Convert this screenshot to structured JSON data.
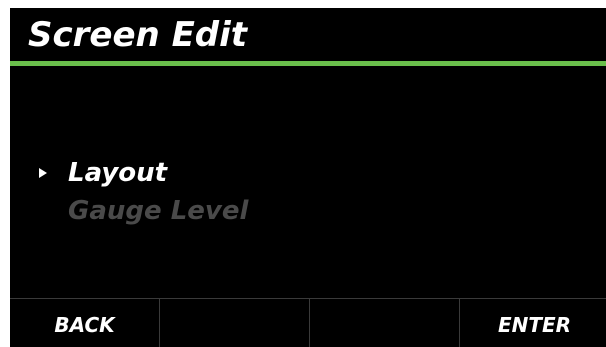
{
  "header": {
    "title": "Screen Edit",
    "accent_color": "#6abf4b"
  },
  "menu": {
    "items": [
      {
        "label": "Layout",
        "state": "selected"
      },
      {
        "label": "Gauge Level",
        "state": "disabled"
      }
    ]
  },
  "softkeys": [
    {
      "label": "BACK"
    },
    {
      "label": ""
    },
    {
      "label": ""
    },
    {
      "label": "ENTER"
    }
  ]
}
